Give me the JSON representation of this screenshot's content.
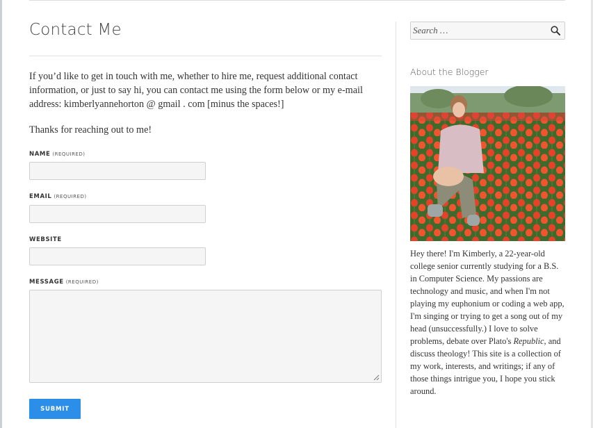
{
  "page": {
    "title": "Contact Me",
    "intro": "If you’d like to get in touch with me, whether to hire me, request additional contact information, or just to say hi, you can contact me using the form below or my e-mail address: kimberlyannehorton @ gmail . com [minus the spaces!]",
    "thanks": "Thanks for reaching out to me!"
  },
  "form": {
    "name_label": "NAME",
    "email_label": "EMAIL",
    "website_label": "WEBSITE",
    "message_label": "MESSAGE",
    "required_text": "(REQUIRED)",
    "submit_label": "SUBMIT"
  },
  "sidebar": {
    "search_placeholder": "Search …",
    "widget_title": "About the Blogger",
    "bio_before": "Hey there! I'm Kimberly, a 22-year-old college senior currently studying for a B.S. in Computer Science. My passions are technology and music, and when I'm not playing my euphonium or coding a web app, I'm singing or trying to get a song out of my head (unsuccessfully.) I love to solve problems, debate over Plato's ",
    "bio_italic": "Republic",
    "bio_after": ", and discuss theology! This site is a collection of my work, interests, and writings; if any of those things intrigue you, I hope you stick around."
  },
  "colors": {
    "accent": "#2b8ee8",
    "input_bg": "#f5f5f5",
    "border": "#cfcfcf",
    "text": "#333333"
  },
  "icons": [
    "search-icon",
    "resize-grip-icon"
  ]
}
